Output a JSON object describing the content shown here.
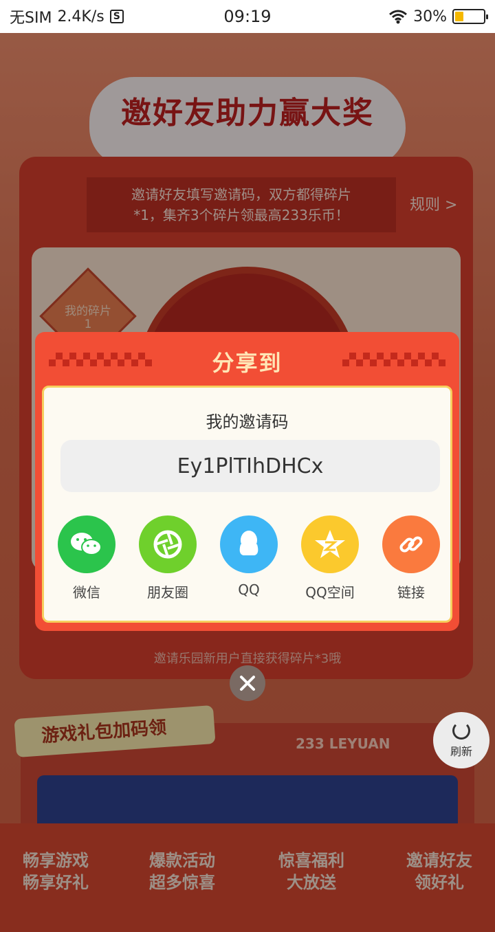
{
  "status_bar": {
    "carrier": "无SIM",
    "speed": "2.4K/s",
    "time": "09:19",
    "battery_percent": "30%",
    "battery_level": 0.3
  },
  "page": {
    "hero_title": "邀好友助力赢大奖",
    "tip_line1": "邀请好友填写邀请码，双方都得碎片",
    "tip_line2": "*1，集齐3个碎片领最高233乐币！",
    "rules_label": "规则 >",
    "fragment_label": "我的碎片",
    "fragment_count": "1",
    "invite_tip": "邀请乐园新用户直接获得碎片*3哦",
    "section2_title": "游戏礼包加码领",
    "leyuan_mark": "233 LEYUAN",
    "refresh_label": "刷新",
    "bottom_items": [
      {
        "line1": "畅享游戏",
        "line2": "畅享好礼"
      },
      {
        "line1": "爆款活动",
        "line2": "超多惊喜"
      },
      {
        "line1": "惊喜福利",
        "line2": "大放送"
      },
      {
        "line1": "邀请好友",
        "line2": "领好礼"
      }
    ]
  },
  "modal": {
    "title": "分享到",
    "code_label": "我的邀请码",
    "invite_code": "Ey1PlTIhDHCx",
    "share_targets": [
      {
        "label": "微信",
        "icon": "wechat-icon",
        "color": "#2bc44c"
      },
      {
        "label": "朋友圈",
        "icon": "moments-icon",
        "color": "#6fd02c"
      },
      {
        "label": "QQ",
        "icon": "qq-icon",
        "color": "#3eb6f5"
      },
      {
        "label": "QQ空间",
        "icon": "qzone-icon",
        "color": "#fbc92d"
      },
      {
        "label": "链接",
        "icon": "link-icon",
        "color": "#fa7a3e"
      }
    ]
  }
}
